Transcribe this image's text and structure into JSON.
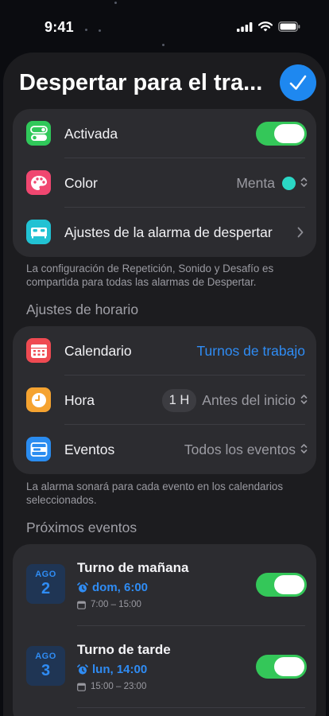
{
  "status": {
    "time": "9:41"
  },
  "header": {
    "title": "Despertar para el tra..."
  },
  "settings": {
    "active_label": "Activada",
    "color_label": "Color",
    "color_value": "Menta",
    "color_swatch": "#2bd7c5",
    "alarm_settings_label": "Ajustes de la alarma de despertar",
    "note": "La configuración de Repetición, Sonido y Desafío es compartida para todas las alarmas de Despertar."
  },
  "schedule": {
    "section_title": "Ajustes de horario",
    "calendar_label": "Calendario",
    "calendar_value": "Turnos de trabajo",
    "time_label": "Hora",
    "time_offset": "1 H",
    "time_value": "Antes del inicio",
    "events_label": "Eventos",
    "events_value": "Todos los eventos",
    "note": "La alarma sonará para cada evento en los calendarios seleccionados."
  },
  "upcoming": {
    "section_title": "Próximos eventos",
    "events": [
      {
        "month": "AGO",
        "day": "2",
        "title": "Turno de mañana",
        "alarm": "dom, 6:00",
        "range": "7:00 – 15:00",
        "enabled": true
      },
      {
        "month": "AGO",
        "day": "3",
        "title": "Turno de tarde",
        "alarm": "lun, 14:00",
        "range": "15:00 – 23:00",
        "enabled": true
      }
    ]
  },
  "colors": {
    "accent": "#2f8cf4",
    "toggle_on": "#34c759",
    "card": "#2c2c30",
    "sheet": "#1c1c1f"
  }
}
